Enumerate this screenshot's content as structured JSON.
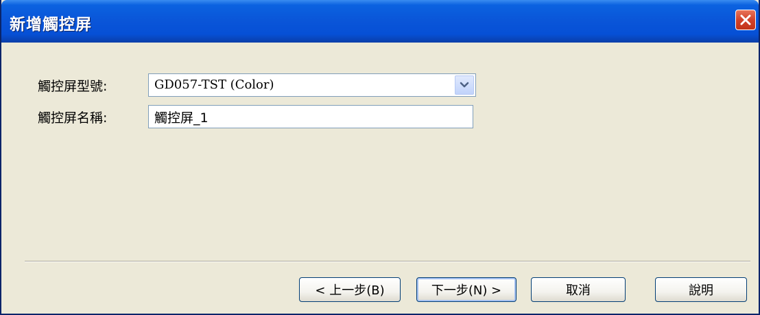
{
  "window": {
    "title": "新增觸控屏"
  },
  "form": {
    "model_label": "觸控屏型號:",
    "model_value": "GD057-TST (Color)",
    "name_label": "觸控屏名稱:",
    "name_value": "觸控屏_1"
  },
  "buttons": {
    "back": "< 上一步(B)",
    "next": "下一步(N) >",
    "cancel": "取消",
    "help": "說明"
  },
  "colors": {
    "titlebar": "#0a55d8",
    "background": "#ece9d8",
    "close_button": "#d1422a"
  },
  "icons": {
    "close": "close-icon",
    "dropdown": "chevron-down-icon"
  }
}
